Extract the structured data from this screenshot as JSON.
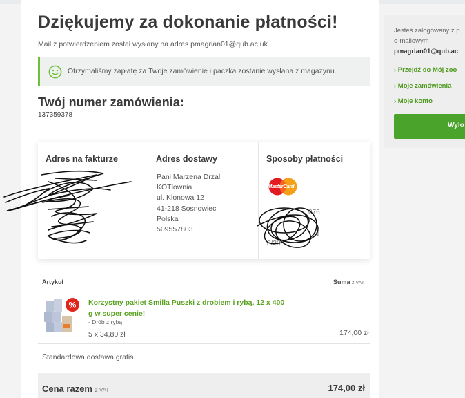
{
  "page": {
    "title": "Dziękujemy za dokonanie płatności!",
    "confirmation_mail": "Mail z potwierdzeniem został wysłany na adres pmagrian01@qub.ac.uk",
    "notice": "Otrzymaliśmy zapłatę za Twoje zamówienie i paczka zostanie wysłana z magazynu.",
    "order_heading": "Twój numer zamówienia:",
    "order_number": "137359378"
  },
  "billing": {
    "heading": "Adres na fakturze"
  },
  "delivery": {
    "heading": "Adres dostawy",
    "lines": [
      "Pani Marzena Drzal",
      "KOTlownia",
      "ul. Klonowa 12",
      "41-218 Sosnowiec",
      "Polska",
      "509557803"
    ]
  },
  "payment": {
    "heading": "Sposoby płatności",
    "card_brand": "MasterCard",
    "partial_lines": [
      "076",
      "N",
      "8/20"
    ]
  },
  "items_table": {
    "col_article": "Artykuł",
    "col_sum": "Suma",
    "col_sum_note": "z VAT",
    "items": [
      {
        "name": "Korzystny pakiet Smilla Puszki z drobiem i rybą, 12 x 400 g w super cenie!",
        "variant": "- Drób z rybą",
        "quantity": "5 x 34,80 zł",
        "price": "174,00 zł"
      }
    ],
    "shipping": "Standardowa dostawa gratis",
    "total_label": "Cena razem",
    "total_note": "z VAT",
    "total_value": "174,00 zł"
  },
  "sidebar": {
    "logged_in_1": "Jesteś zalogowany z p",
    "logged_in_2": "e-mailowym",
    "email": "pmagrian01@qub.ac",
    "links": [
      "› Przejdź do Mój zoo",
      "› Moje zamówienia",
      "› Moje konto"
    ],
    "logout_label": "Wylo"
  },
  "colors": {
    "accent_green": "#4aa32a",
    "link_green": "#5aa321",
    "title_dark": "#3a3a3a"
  }
}
